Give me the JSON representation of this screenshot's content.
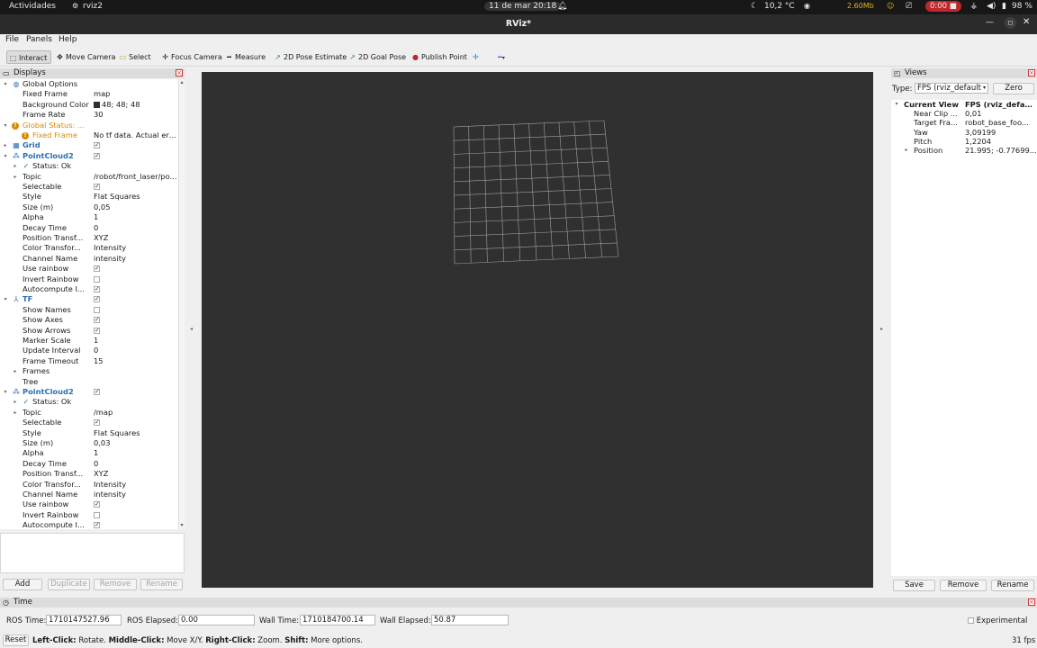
{
  "system_bar": {
    "activities": "Actividades",
    "app_name": "rviz2",
    "datetime": "11 de mar  20:18",
    "temperature": "10,2 °C",
    "network_speed": "2.60Mb",
    "recording_time": "0:00",
    "battery": "98 %"
  },
  "window": {
    "title": "RViz*"
  },
  "menu": {
    "file": "File",
    "panels": "Panels",
    "help": "Help"
  },
  "toolbar": {
    "interact": "Interact",
    "move_camera": "Move Camera",
    "select": "Select",
    "focus_camera": "Focus Camera",
    "measure": "Measure",
    "pose_estimate": "2D Pose Estimate",
    "goal_pose": "2D Goal Pose",
    "publish_point": "Publish Point"
  },
  "displays": {
    "title": "Displays",
    "rows": [
      {
        "label": "Global Options",
        "value": "",
        "indent": 0,
        "expanded": true,
        "icon": "globe-icon",
        "kind": "header"
      },
      {
        "label": "Fixed Frame",
        "value": "map",
        "indent": 1
      },
      {
        "label": "Background Color",
        "value": "48; 48; 48",
        "indent": 1,
        "swatch": true
      },
      {
        "label": "Frame Rate",
        "value": "30",
        "indent": 1
      },
      {
        "label": "Global Status: ...",
        "value": "",
        "indent": 0,
        "expanded": true,
        "icon": "warning-icon",
        "kind": "warn"
      },
      {
        "label": "Fixed Frame",
        "value": "No tf data.  Actual err...",
        "indent": 1,
        "icon": "warning-icon",
        "kind": "warnchild"
      },
      {
        "label": "Grid",
        "value": "",
        "indent": 0,
        "expanded": false,
        "icon": "grid-icon",
        "kind": "display",
        "check": true
      },
      {
        "label": "PointCloud2",
        "value": "",
        "indent": 0,
        "expanded": true,
        "icon": "pointcloud-icon",
        "kind": "display",
        "check": true
      },
      {
        "label": "Status: Ok",
        "value": "",
        "indent": 1,
        "expanded": false,
        "icon": "check-icon"
      },
      {
        "label": "Topic",
        "value": "/robot/front_laser/po...",
        "indent": 1,
        "expanded": false
      },
      {
        "label": "Selectable",
        "value": "",
        "indent": 1,
        "check": true
      },
      {
        "label": "Style",
        "value": "Flat Squares",
        "indent": 1
      },
      {
        "label": "Size (m)",
        "value": "0,05",
        "indent": 1
      },
      {
        "label": "Alpha",
        "value": "1",
        "indent": 1
      },
      {
        "label": "Decay Time",
        "value": "0",
        "indent": 1
      },
      {
        "label": "Position Transf...",
        "value": "XYZ",
        "indent": 1
      },
      {
        "label": "Color Transfor...",
        "value": "Intensity",
        "indent": 1
      },
      {
        "label": "Channel Name",
        "value": "intensity",
        "indent": 1
      },
      {
        "label": "Use rainbow",
        "value": "",
        "indent": 1,
        "check": true
      },
      {
        "label": "Invert Rainbow",
        "value": "",
        "indent": 1,
        "check": false
      },
      {
        "label": "Autocompute I...",
        "value": "",
        "indent": 1,
        "check": true
      },
      {
        "label": "TF",
        "value": "",
        "indent": 0,
        "expanded": true,
        "icon": "tf-icon",
        "kind": "display",
        "check": true
      },
      {
        "label": "Show Names",
        "value": "",
        "indent": 1,
        "check": false
      },
      {
        "label": "Show Axes",
        "value": "",
        "indent": 1,
        "check": true
      },
      {
        "label": "Show Arrows",
        "value": "",
        "indent": 1,
        "check": true
      },
      {
        "label": "Marker Scale",
        "value": "1",
        "indent": 1
      },
      {
        "label": "Update Interval",
        "value": "0",
        "indent": 1
      },
      {
        "label": "Frame Timeout",
        "value": "15",
        "indent": 1
      },
      {
        "label": "Frames",
        "value": "",
        "indent": 1,
        "expanded": false
      },
      {
        "label": "Tree",
        "value": "",
        "indent": 1
      },
      {
        "label": "PointCloud2",
        "value": "",
        "indent": 0,
        "expanded": true,
        "icon": "pointcloud-icon",
        "kind": "display",
        "check": true
      },
      {
        "label": "Status: Ok",
        "value": "",
        "indent": 1,
        "expanded": false,
        "icon": "check-icon"
      },
      {
        "label": "Topic",
        "value": "/map",
        "indent": 1,
        "expanded": false
      },
      {
        "label": "Selectable",
        "value": "",
        "indent": 1,
        "check": true
      },
      {
        "label": "Style",
        "value": "Flat Squares",
        "indent": 1
      },
      {
        "label": "Size (m)",
        "value": "0,03",
        "indent": 1
      },
      {
        "label": "Alpha",
        "value": "1",
        "indent": 1
      },
      {
        "label": "Decay Time",
        "value": "0",
        "indent": 1
      },
      {
        "label": "Position Transf...",
        "value": "XYZ",
        "indent": 1
      },
      {
        "label": "Color Transfor...",
        "value": "Intensity",
        "indent": 1
      },
      {
        "label": "Channel Name",
        "value": "intensity",
        "indent": 1
      },
      {
        "label": "Use rainbow",
        "value": "",
        "indent": 1,
        "check": true
      },
      {
        "label": "Invert Rainbow",
        "value": "",
        "indent": 1,
        "check": false
      },
      {
        "label": "Autocompute I...",
        "value": "",
        "indent": 1,
        "check": true
      }
    ],
    "buttons": {
      "add": "Add",
      "duplicate": "Duplicate",
      "remove": "Remove",
      "rename": "Rename"
    }
  },
  "views": {
    "title": "Views",
    "type_label": "Type:",
    "type_value": "FPS (rviz_default",
    "zero": "Zero",
    "rows": [
      {
        "label": "Current View",
        "value": "FPS (rviz_defau...",
        "indent": 0,
        "expanded": true,
        "bold": true
      },
      {
        "label": "Near Clip ...",
        "value": "0,01",
        "indent": 1
      },
      {
        "label": "Target Fra...",
        "value": "robot_base_foo...",
        "indent": 1
      },
      {
        "label": "Yaw",
        "value": "3,09199",
        "indent": 1
      },
      {
        "label": "Pitch",
        "value": "1,2204",
        "indent": 1
      },
      {
        "label": "Position",
        "value": "21.995; -0.77699...",
        "indent": 1,
        "expanded": false
      }
    ],
    "buttons": {
      "save": "Save",
      "remove": "Remove",
      "rename": "Rename"
    }
  },
  "time": {
    "title": "Time",
    "ros_time_label": "ROS Time:",
    "ros_time": "1710147527.96",
    "ros_elapsed_label": "ROS Elapsed:",
    "ros_elapsed": "0.00",
    "wall_time_label": "Wall Time:",
    "wall_time": "1710184700.14",
    "wall_elapsed_label": "Wall Elapsed:",
    "wall_elapsed": "50.87",
    "experimental": "Experimental"
  },
  "status": {
    "reset": "Reset",
    "left_click": "Left-Click:",
    "left_desc": " Rotate. ",
    "middle_click": "Middle-Click:",
    "middle_desc": " Move X/Y. ",
    "right_click": "Right-Click:",
    "right_desc": " Zoom. ",
    "shift": "Shift:",
    "shift_desc": " More options.",
    "fps": "31 fps"
  },
  "colors": {
    "viewport_bg": "#303030",
    "grid_line": "#a0a0a0",
    "display_blue": "#2a6fb5",
    "warning": "#d98a00"
  }
}
